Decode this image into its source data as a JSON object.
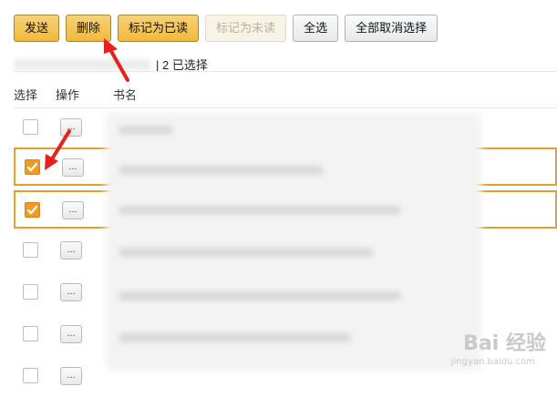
{
  "toolbar": {
    "send_label": "发送",
    "delete_label": "删除",
    "mark_read_label": "标记为已读",
    "mark_unread_label": "标记为未读",
    "select_all_label": "全选",
    "deselect_all_label": "全部取消选择"
  },
  "status": {
    "selection_text": "| 2 已选择"
  },
  "table": {
    "headers": {
      "select": "选择",
      "actions": "操作",
      "title": "书名"
    },
    "more_label": "...",
    "rows": [
      {
        "checked": false,
        "title_suffix": ""
      },
      {
        "checked": true,
        "title_suffix": ""
      },
      {
        "checked": true,
        "title_suffix": ""
      },
      {
        "checked": false,
        "title_suffix": ") (En..."
      },
      {
        "checked": false,
        "title_suffix": ""
      },
      {
        "checked": false,
        "title_suffix": ""
      },
      {
        "checked": false,
        "title_suffix": ""
      }
    ]
  },
  "watermark": {
    "brand": "Bai 经验",
    "url": "jingyan.baidu.com"
  },
  "colors": {
    "accent_orange": "#f19a1b",
    "selected_border": "#e79e2a",
    "arrow_red": "#e8201b"
  }
}
